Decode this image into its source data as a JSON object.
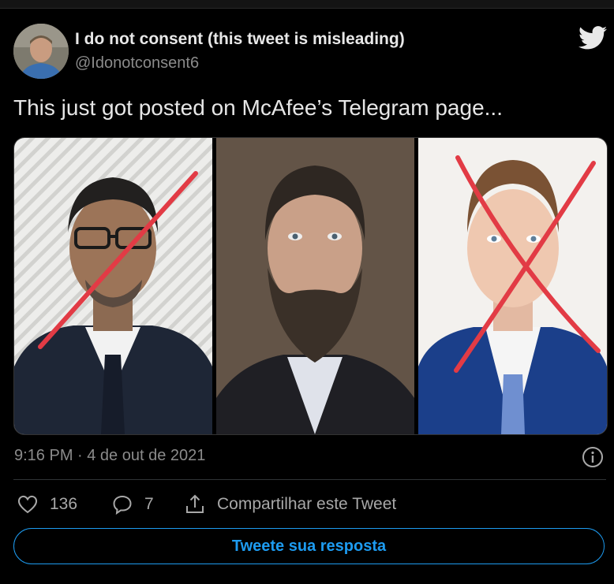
{
  "author": {
    "name": "I do not consent (this tweet is misleading)",
    "handle": "@Idonotconsent6"
  },
  "tweet": {
    "text": "This just got posted on McAfee’s Telegram page...",
    "timestamp": "9:16 PM · 4 de out de 2021"
  },
  "media": {
    "images": [
      {
        "subject": "man-with-glasses-crossed-out",
        "mark": "single red slash"
      },
      {
        "subject": "bearded-man",
        "mark": "none"
      },
      {
        "subject": "man-in-suit-crossed-out",
        "mark": "red X"
      }
    ]
  },
  "actions": {
    "likes": "136",
    "replies": "7",
    "share_label": "Compartilhar este Tweet"
  },
  "reply_button": {
    "label": "Tweete sua resposta"
  },
  "icons": [
    "twitter-bird-icon",
    "info-icon",
    "heart-icon",
    "reply-icon",
    "share-icon"
  ],
  "colors": {
    "accent": "#1d9bf0",
    "background": "#000000",
    "cross_mark": "#e23b45"
  }
}
